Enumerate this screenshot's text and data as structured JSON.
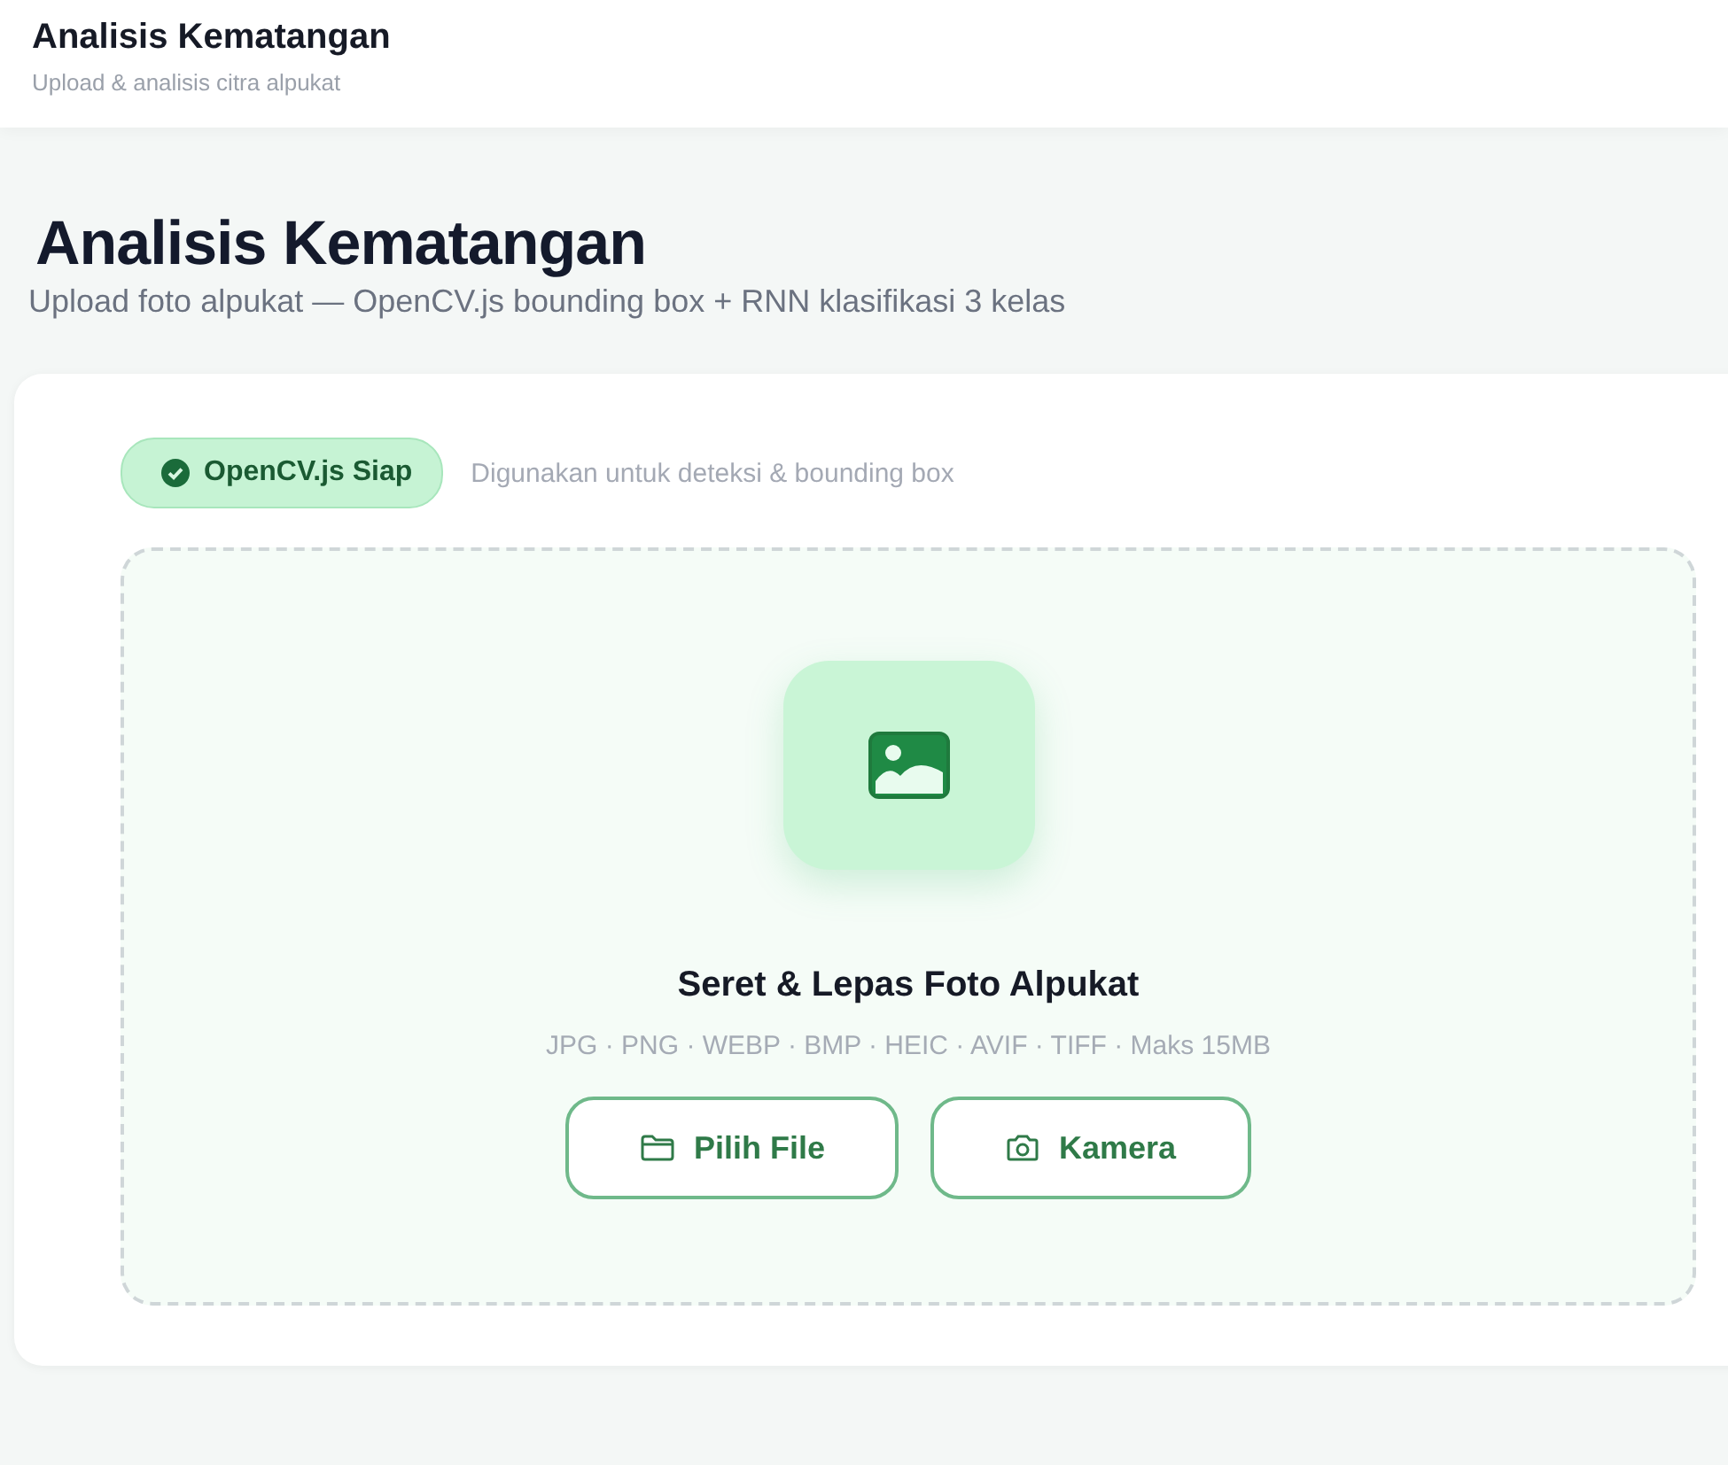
{
  "header": {
    "title": "Analisis Kematangan",
    "subtitle": "Upload & analisis citra alpukat"
  },
  "page": {
    "title": "Analisis Kematangan",
    "subtitle": "Upload foto alpukat — OpenCV.js bounding box + RNN klasifikasi 3 kelas"
  },
  "status": {
    "label": "OpenCV.js Siap",
    "ready": true,
    "note": "Digunakan untuk deteksi & bounding box"
  },
  "dropzone": {
    "title": "Seret & Lepas Foto Alpukat",
    "formats": "JPG · PNG · WEBP · BMP · HEIC · AVIF · TIFF · Maks 15MB",
    "buttons": [
      {
        "label": "Pilih File",
        "kind": "folder"
      },
      {
        "label": "Kamera",
        "kind": "camera"
      }
    ]
  }
}
